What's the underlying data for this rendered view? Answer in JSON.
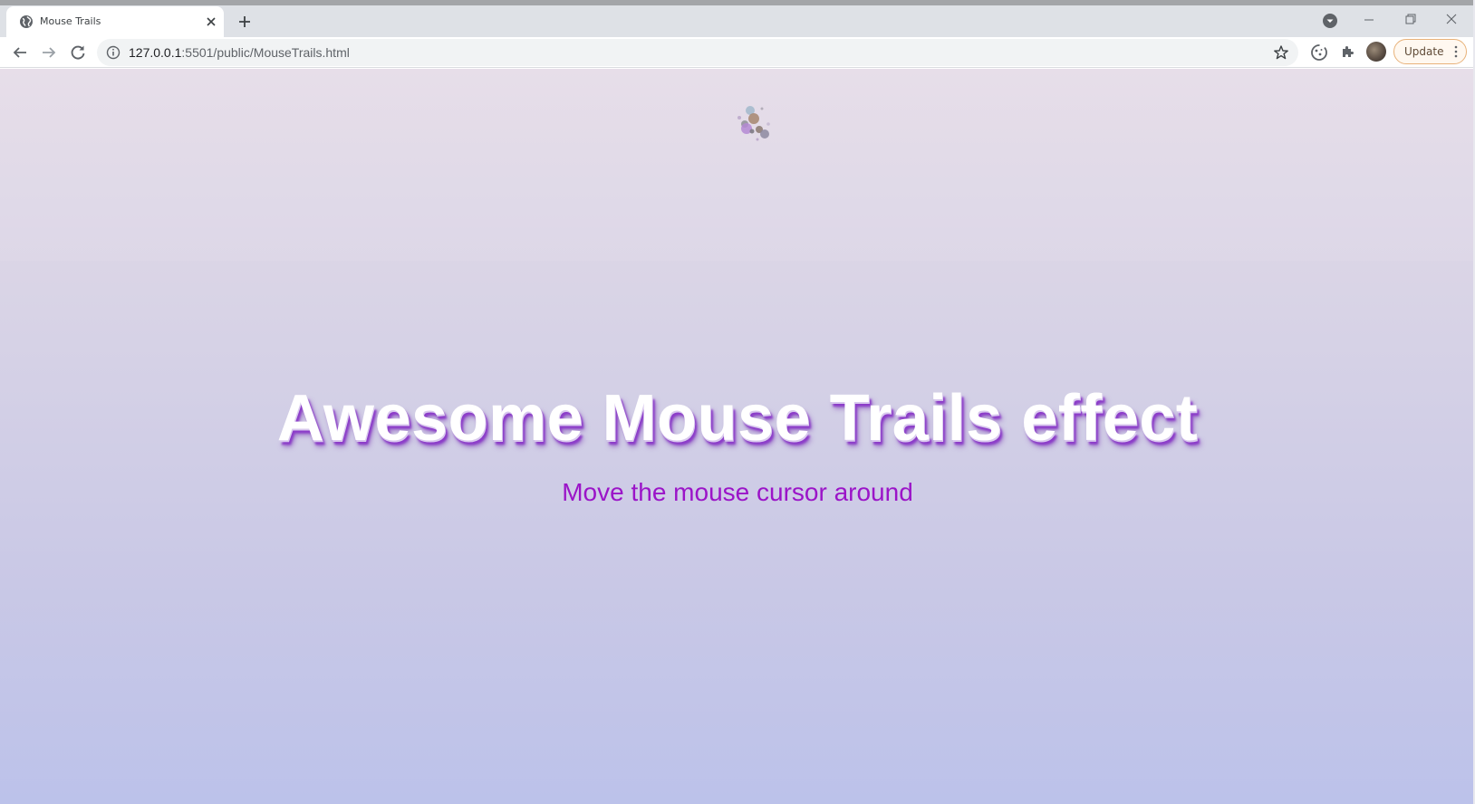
{
  "browser": {
    "tab": {
      "title": "Mouse Trails"
    },
    "url": {
      "host": "127.0.0.1",
      "path": ":5501/public/MouseTrails.html"
    },
    "update_label": "Update"
  },
  "page": {
    "headline": "Awesome Mouse Trails effect",
    "subline": "Move the mouse cursor around",
    "headline_color": "#ffffff",
    "headline_shadow_color": "#8c3cc9",
    "subline_color": "#9b14c8",
    "background_top": "#e6dce8",
    "background_bottom": "#bcc2ea"
  }
}
